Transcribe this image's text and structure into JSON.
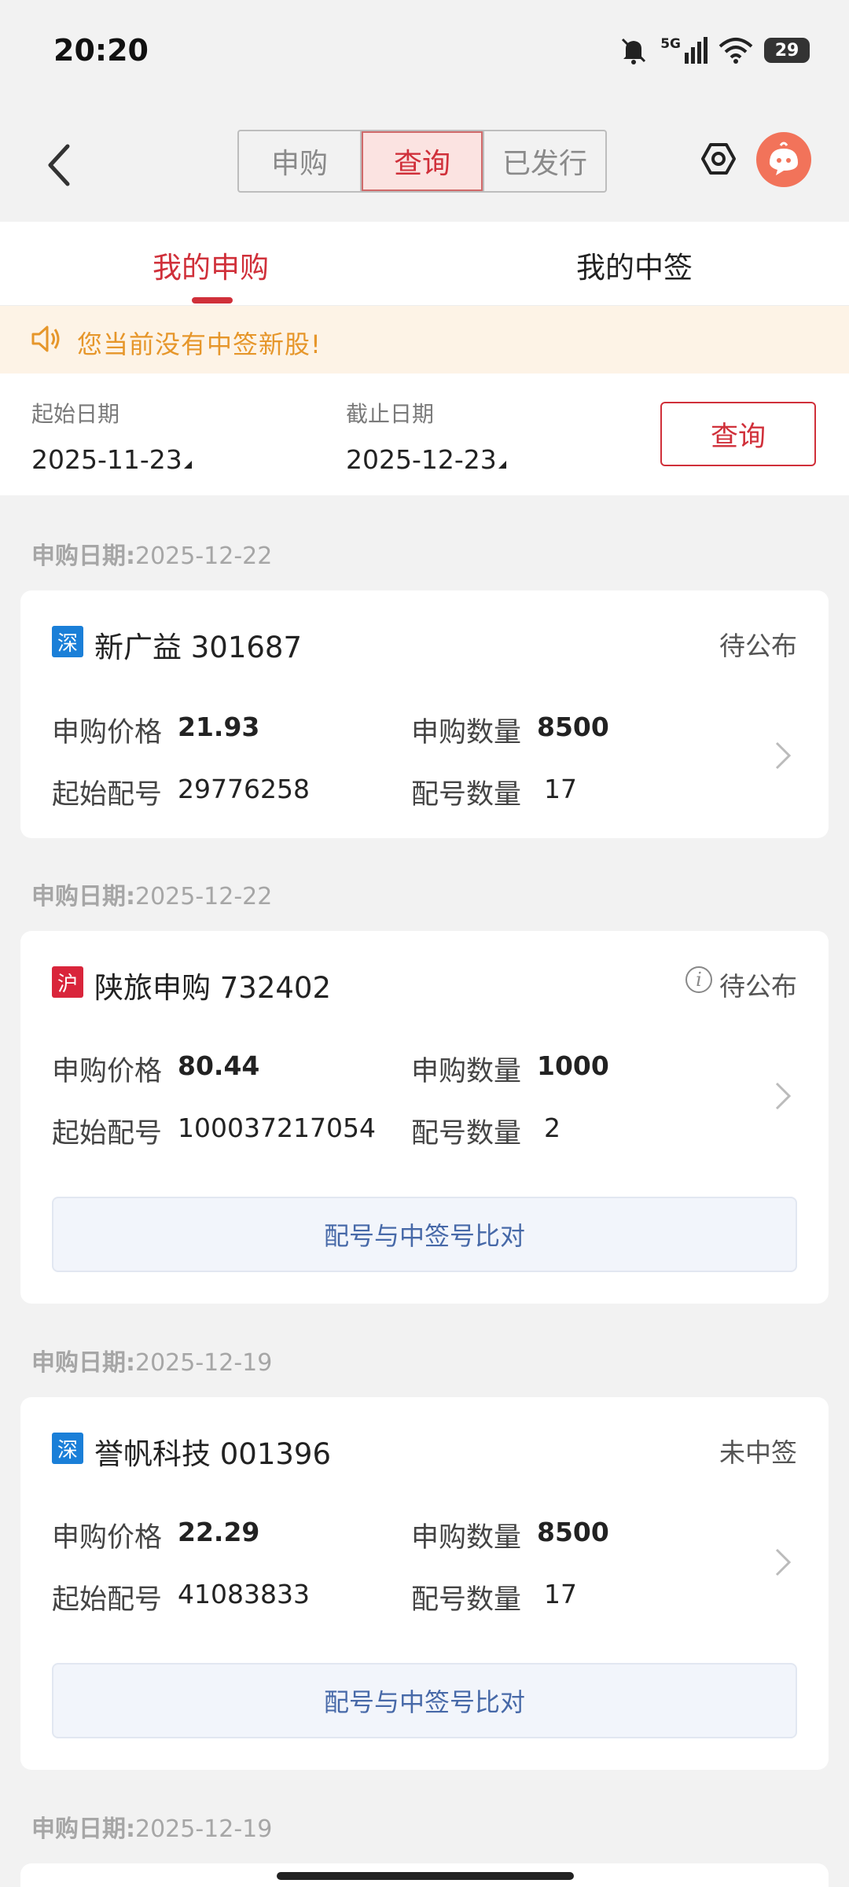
{
  "status_bar": {
    "time": "20:20",
    "battery": "29",
    "network": "5G"
  },
  "header": {
    "segments": [
      "申购",
      "查询",
      "已发行"
    ],
    "active_segment": 1
  },
  "tabs": [
    "我的申购",
    "我的中签"
  ],
  "notice": "您当前没有中签新股!",
  "date_query": {
    "start_label": "起始日期",
    "start_value": "2025-11-23",
    "end_label": "截止日期",
    "end_value": "2025-12-23",
    "button": "查询"
  },
  "sections": [
    {
      "date_label": "申购日期:",
      "date": "2025-12-22",
      "card": {
        "market": "深",
        "name": "新广益 301687",
        "status": "待公布",
        "price_label": "申购价格",
        "price": "21.93",
        "qty_label": "申购数量",
        "qty": "8500",
        "start_no_label": "起始配号",
        "start_no": "29776258",
        "count_label": "配号数量",
        "count": "17"
      }
    },
    {
      "date_label": "申购日期:",
      "date": "2025-12-22",
      "card": {
        "market": "沪",
        "name": "陕旅申购 732402",
        "status": "待公布",
        "price_label": "申购价格",
        "price": "80.44",
        "qty_label": "申购数量",
        "qty": "1000",
        "start_no_label": "起始配号",
        "start_no": "100037217054",
        "count_label": "配号数量",
        "count": "2",
        "compare_button": "配号与中签号比对"
      }
    },
    {
      "date_label": "申购日期:",
      "date": "2025-12-19",
      "card": {
        "market": "深",
        "name": "誉帆科技 001396",
        "status": "未中签",
        "price_label": "申购价格",
        "price": "22.29",
        "qty_label": "申购数量",
        "qty": "8500",
        "start_no_label": "起始配号",
        "start_no": "41083833",
        "count_label": "配号数量",
        "count": "17",
        "compare_button": "配号与中签号比对"
      }
    },
    {
      "date_label": "申购日期:",
      "date": "2025-12-19"
    }
  ],
  "colors": {
    "accent": "#d0303a",
    "notice_text": "#e6962a",
    "sz_badge": "#1a7fd8",
    "sh_badge": "#d9253b"
  }
}
